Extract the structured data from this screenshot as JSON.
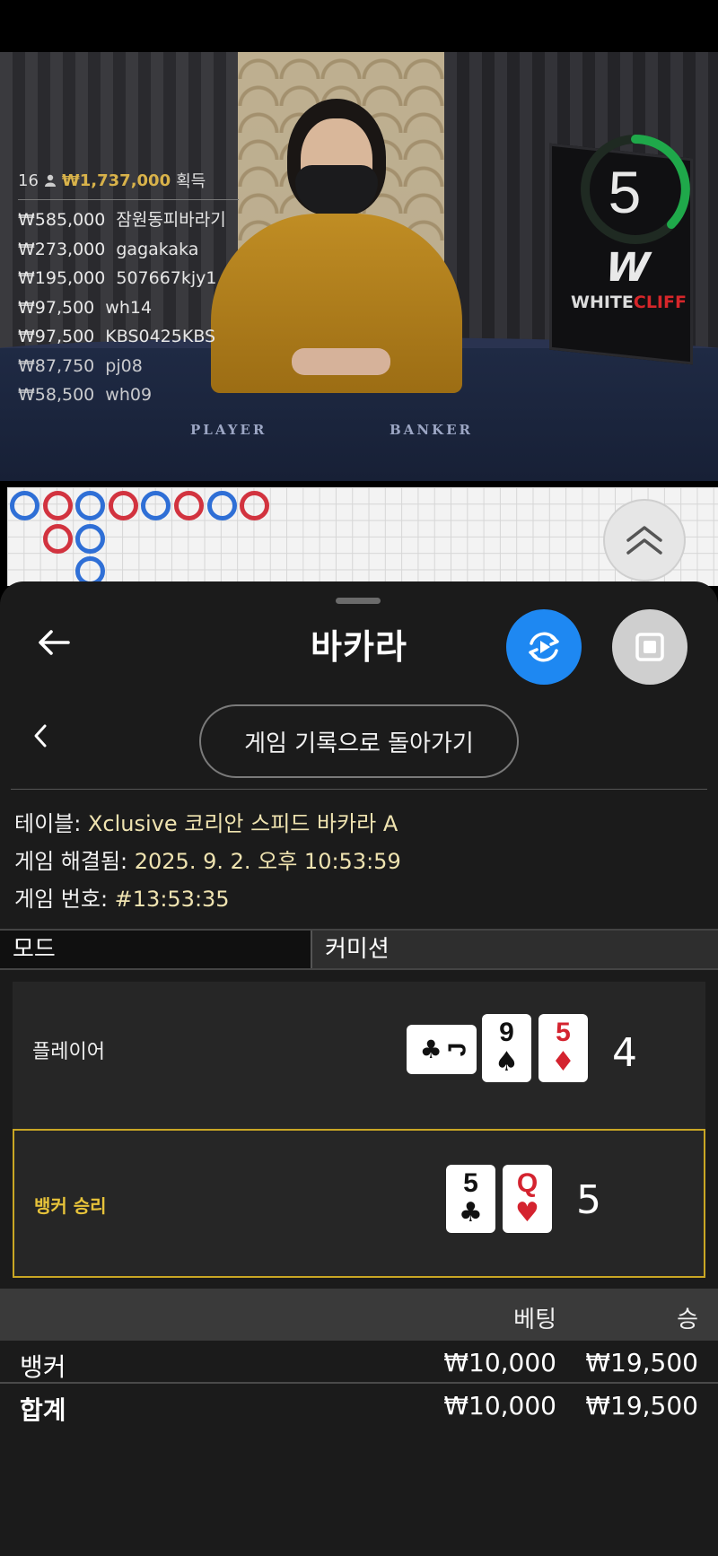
{
  "video": {
    "timer": "5",
    "provider_logo_top": "WHITE",
    "provider_logo_accent": "CLIFF",
    "felt_player": "PLAYER",
    "felt_banker": "BANKER",
    "winners_header": {
      "count": "16",
      "amount": "₩1,737,000",
      "suffix": "획득"
    },
    "winners": [
      {
        "amount": "₩585,000",
        "name": "잠원동피바라기"
      },
      {
        "amount": "₩273,000",
        "name": "gagakaka"
      },
      {
        "amount": "₩195,000",
        "name": "507667kjy1"
      },
      {
        "amount": "₩97,500",
        "name": "wh14"
      },
      {
        "amount": "₩97,500",
        "name": "KBS0425KBS"
      },
      {
        "amount": "₩87,750",
        "name": "pj08"
      },
      {
        "amount": "₩58,500",
        "name": "wh09"
      }
    ]
  },
  "road": {
    "beads": [
      {
        "col": 0,
        "row": 0,
        "side": "player"
      },
      {
        "col": 1,
        "row": 0,
        "side": "banker"
      },
      {
        "col": 2,
        "row": 0,
        "side": "player"
      },
      {
        "col": 3,
        "row": 0,
        "side": "banker"
      },
      {
        "col": 4,
        "row": 0,
        "side": "player"
      },
      {
        "col": 5,
        "row": 0,
        "side": "banker"
      },
      {
        "col": 6,
        "row": 0,
        "side": "player"
      },
      {
        "col": 7,
        "row": 0,
        "side": "banker"
      },
      {
        "col": 1,
        "row": 1,
        "side": "banker"
      },
      {
        "col": 2,
        "row": 1,
        "side": "player"
      },
      {
        "col": 2,
        "row": 2,
        "side": "player"
      }
    ],
    "colors": {
      "player": "#2f6fd6",
      "banker": "#d2333f"
    }
  },
  "sheet": {
    "title": "바카라",
    "history_button": "게임 기록으로 돌아가기",
    "table_label": "테이블: ",
    "table_value": "Xclusive 코리안 스피드 바카라 A",
    "resolved_label": "게임 해결됨: ",
    "resolved_value": "2025. 9. 2. 오후 10:53:59",
    "game_no_label": "게임 번호: ",
    "game_no_value": "#13:53:35",
    "mode_label": "모드",
    "mode_value": "커미션",
    "player": {
      "label": "플레이어",
      "score": "4",
      "cards": [
        {
          "rank": "J",
          "suit": "♣",
          "color": "black",
          "orientation": "sideways"
        },
        {
          "rank": "9",
          "suit": "♠",
          "color": "black"
        },
        {
          "rank": "5",
          "suit": "♦",
          "color": "red"
        }
      ]
    },
    "banker": {
      "label": "뱅커 승리",
      "score": "5",
      "cards": [
        {
          "rank": "5",
          "suit": "♣",
          "color": "black"
        },
        {
          "rank": "Q",
          "suit": "♥",
          "color": "red"
        }
      ]
    },
    "bets": {
      "col_bet": "베팅",
      "col_win": "승",
      "rows": [
        {
          "label": "뱅커",
          "bet": "₩10,000",
          "win": "₩19,500"
        }
      ],
      "total": {
        "label": "합계",
        "bet": "₩10,000",
        "win": "₩19,500"
      }
    },
    "accent_color": "#1e88f2",
    "winner_border_color": "#c9a624"
  }
}
